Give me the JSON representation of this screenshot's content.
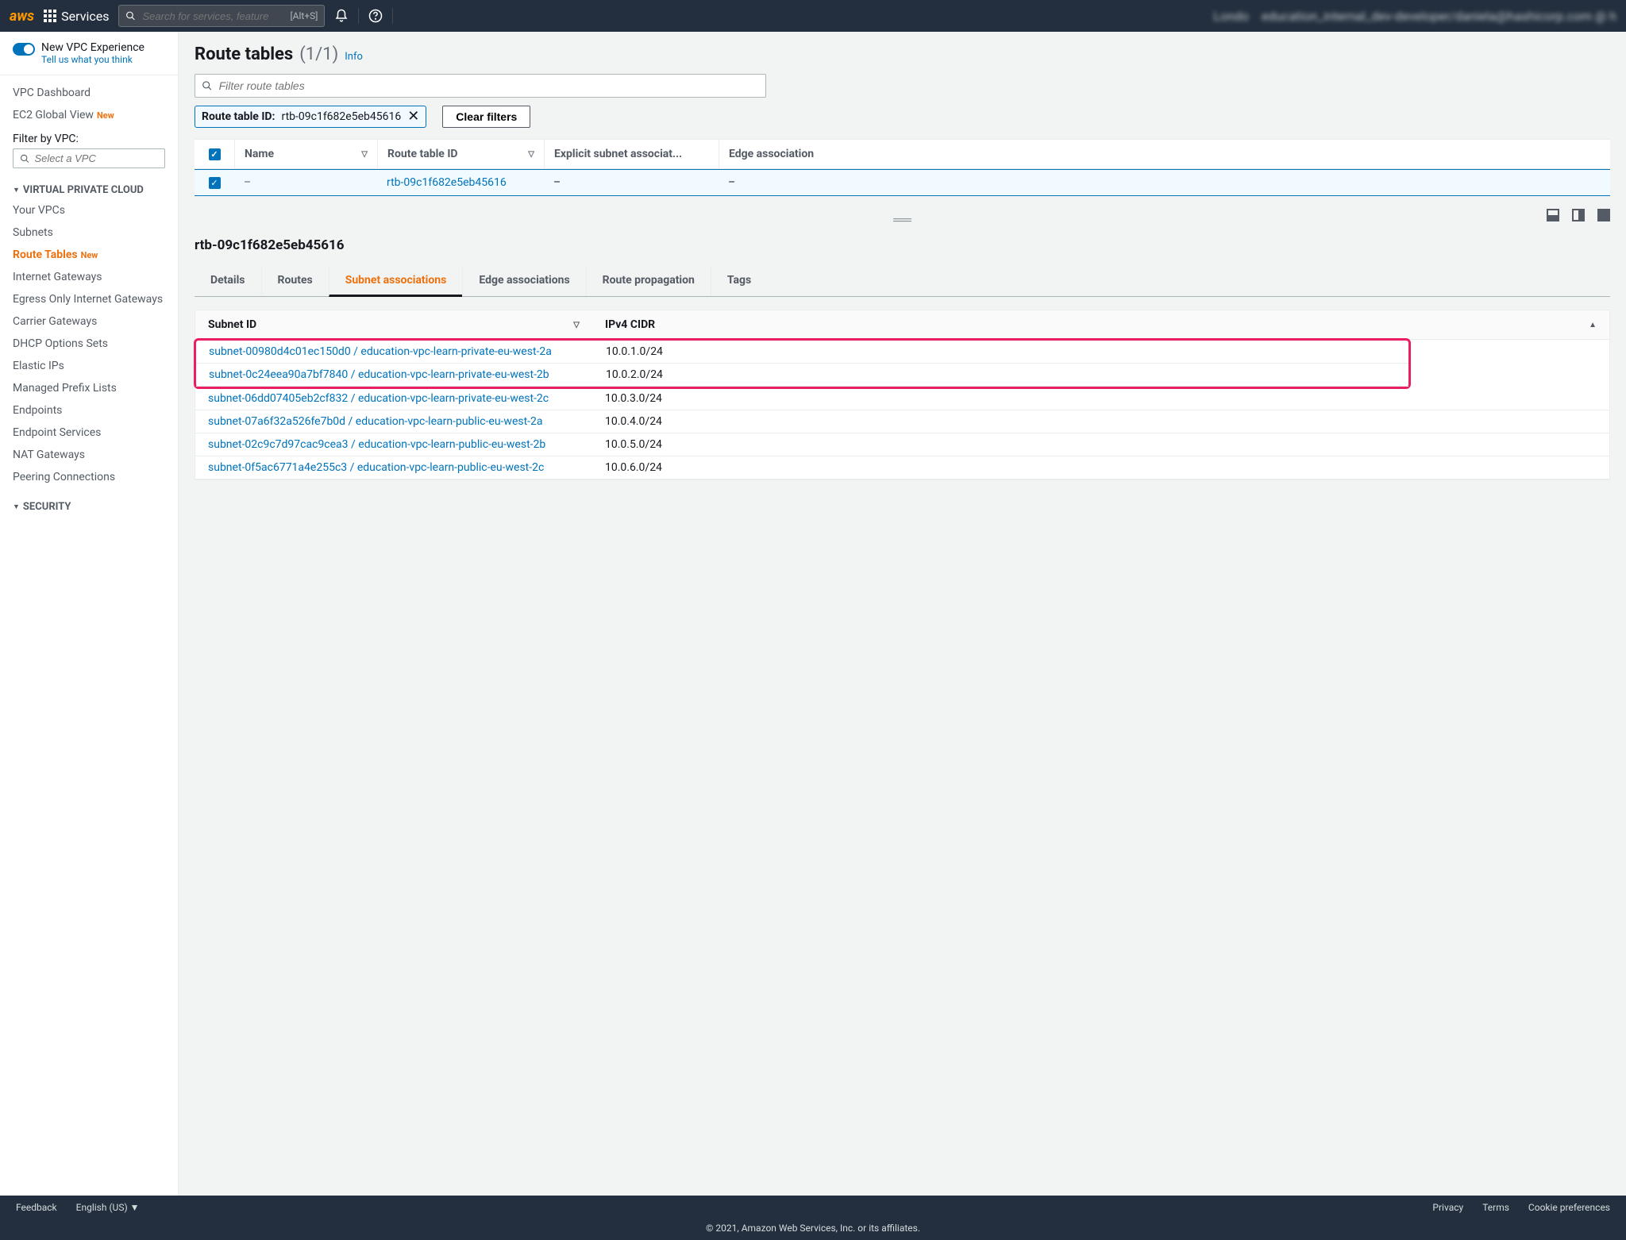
{
  "topnav": {
    "services_label": "Services",
    "search_placeholder": "Search for services, feature",
    "search_kbd": "[Alt+S]",
    "region": "Londo",
    "account": "education_internal_dev-developer/daniela@hashicorp.com @ h"
  },
  "sidebar": {
    "experience_title": "New VPC Experience",
    "experience_link": "Tell us what you think",
    "dashboard": "VPC Dashboard",
    "ec2global": "EC2 Global View",
    "new_badge": "New",
    "filter_label": "Filter by VPC:",
    "filter_placeholder": "Select a VPC",
    "section_vpc": "VIRTUAL PRIVATE CLOUD",
    "items": {
      "your_vpcs": "Your VPCs",
      "subnets": "Subnets",
      "route_tables": "Route Tables",
      "internet_gateways": "Internet Gateways",
      "egress_only": "Egress Only Internet Gateways",
      "carrier_gateways": "Carrier Gateways",
      "dhcp": "DHCP Options Sets",
      "elastic_ips": "Elastic IPs",
      "managed_prefix": "Managed Prefix Lists",
      "endpoints": "Endpoints",
      "endpoint_services": "Endpoint Services",
      "nat_gateways": "NAT Gateways",
      "peering": "Peering Connections"
    },
    "section_security": "SECURITY"
  },
  "page": {
    "title": "Route tables",
    "count": "(1/1)",
    "info": "Info",
    "filter_placeholder": "Filter route tables",
    "chip_label": "Route table ID:",
    "chip_value": "rtb-09c1f682e5eb45616",
    "clear_filters": "Clear filters"
  },
  "table": {
    "headers": {
      "name": "Name",
      "route_table_id": "Route table ID",
      "explicit_subnet": "Explicit subnet associat...",
      "edge_assoc": "Edge association"
    },
    "row": {
      "name": "–",
      "id": "rtb-09c1f682e5eb45616",
      "subnet": "–",
      "edge": "–"
    }
  },
  "detail": {
    "title": "rtb-09c1f682e5eb45616",
    "tabs": {
      "details": "Details",
      "routes": "Routes",
      "subnet_assoc": "Subnet associations",
      "edge_assoc": "Edge associations",
      "route_prop": "Route propagation",
      "tags": "Tags"
    },
    "subnet_id_header": "Subnet ID",
    "cidr_header": "IPv4 CIDR",
    "subnets": [
      {
        "id": "subnet-00980d4c01ec150d0 / education-vpc-learn-private-eu-west-2a",
        "cidr": "10.0.1.0/24",
        "hl": true
      },
      {
        "id": "subnet-0c24eea90a7bf7840 / education-vpc-learn-private-eu-west-2b",
        "cidr": "10.0.2.0/24",
        "hl": true
      },
      {
        "id": "subnet-06dd07405eb2cf832 / education-vpc-learn-private-eu-west-2c",
        "cidr": "10.0.3.0/24",
        "hl": false
      },
      {
        "id": "subnet-07a6f32a526fe7b0d / education-vpc-learn-public-eu-west-2a",
        "cidr": "10.0.4.0/24",
        "hl": false
      },
      {
        "id": "subnet-02c9c7d97cac9cea3 / education-vpc-learn-public-eu-west-2b",
        "cidr": "10.0.5.0/24",
        "hl": false
      },
      {
        "id": "subnet-0f5ac6771a4e255c3 / education-vpc-learn-public-eu-west-2c",
        "cidr": "10.0.6.0/24",
        "hl": false
      }
    ]
  },
  "footer": {
    "feedback": "Feedback",
    "language": "English (US)",
    "privacy": "Privacy",
    "terms": "Terms",
    "cookies": "Cookie preferences",
    "copyright": "© 2021, Amazon Web Services, Inc. or its affiliates."
  }
}
